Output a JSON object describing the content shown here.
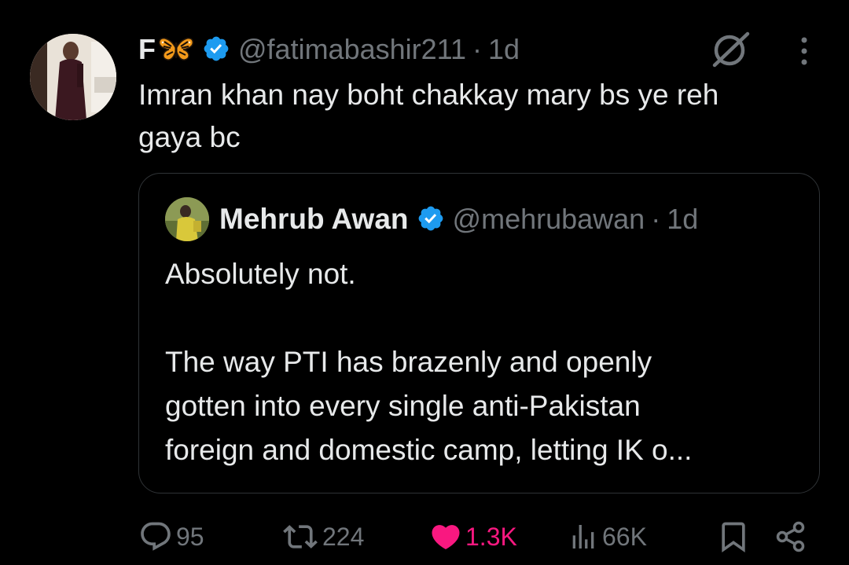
{
  "tweet": {
    "author": {
      "display_name": "F",
      "emoji": "butterfly",
      "handle": "@fatimabashir211",
      "time": "1d",
      "separator": "·"
    },
    "text_line1": "Imran khan nay boht chakkay mary bs ye reh",
    "text_line2": "gaya bc"
  },
  "quote": {
    "author": {
      "display_name": "Mehrub Awan",
      "handle": "@mehrubawan",
      "time": "1d",
      "separator": "·"
    },
    "line1": "Absolutely not.",
    "line2": "The way PTI has brazenly and openly",
    "line3": "gotten into every single anti-Pakistan",
    "line4": "foreign and domestic camp, letting IK o..."
  },
  "actions": {
    "replies": "95",
    "reposts": "224",
    "likes": "1.3K",
    "views": "66K",
    "liked": true
  },
  "icons": {
    "verified": "verified-badge-icon",
    "grok": "grok-icon",
    "more": "more-icon",
    "reply": "reply-icon",
    "repost": "repost-icon",
    "like": "heart-icon",
    "views": "views-icon",
    "bookmark": "bookmark-icon",
    "share": "share-icon"
  },
  "colors": {
    "background": "#000000",
    "text": "#e7e9ea",
    "muted": "#71767b",
    "verified": "#1d9bf0",
    "like": "#f91880",
    "border": "#2f3336"
  }
}
